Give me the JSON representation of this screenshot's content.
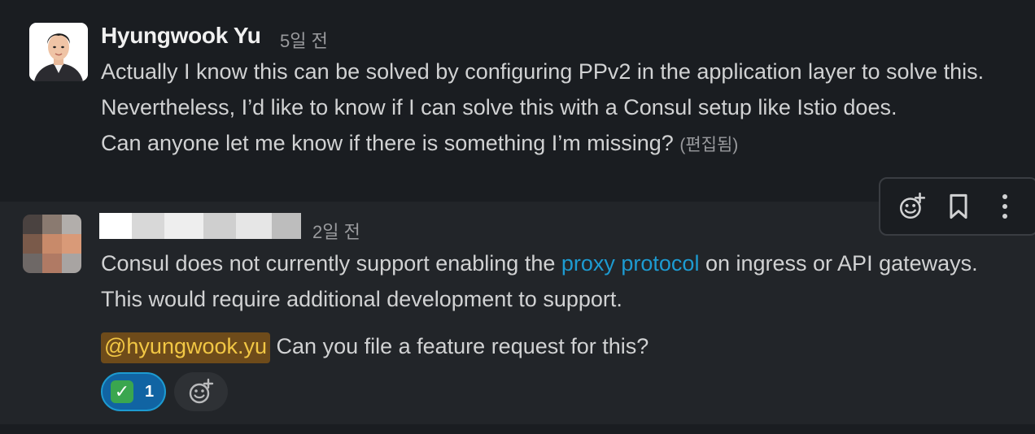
{
  "messages": [
    {
      "sender": "Hyungwook Yu",
      "timestamp": "5일 전",
      "lines": [
        "Actually I know this can be solved by configuring PPv2 in the application layer to solve this.",
        "Nevertheless, I’d like to know if I can solve this with a Consul setup like Istio does.",
        "Can anyone let me know if there is something I’m missing?"
      ],
      "edited_label": "(편집됨)"
    },
    {
      "sender_redacted": true,
      "timestamp": "2일 전",
      "paragraph1_before_link": "Consul does not currently support enabling the ",
      "link_text": "proxy protocol",
      "paragraph1_after_link": " on ingress or API gateways. This would require additional development to support.",
      "mention": "@hyungwook.yu",
      "paragraph2": " Can you file a feature request for this?",
      "reaction": {
        "emoji": "✅",
        "count": "1"
      }
    }
  ],
  "toolbar": {
    "icons": [
      "add-reaction-icon",
      "bookmark-icon",
      "more-vertical-icon"
    ]
  },
  "colors": {
    "background": "#1a1d21",
    "hover_background": "#222529",
    "link": "#1d9bd1",
    "mention_bg": "#6e4b1a",
    "mention_text": "#f2c744",
    "reaction_bg": "#1164a3"
  }
}
